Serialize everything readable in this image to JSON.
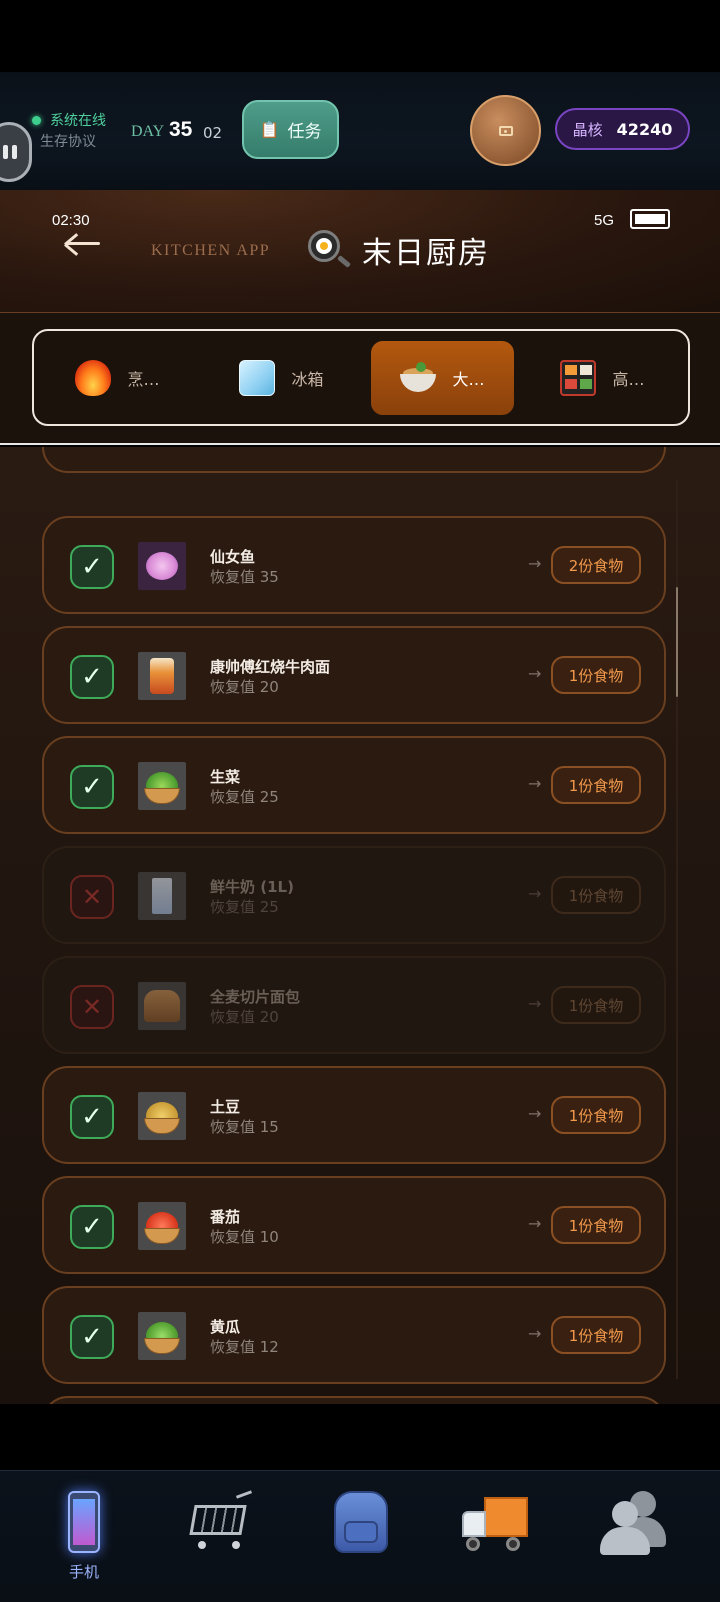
{
  "hud": {
    "status_online": "系统在线",
    "protocol": "生存协议",
    "day_label": "DAY",
    "day_number": "35",
    "day_sub": "02",
    "task_label": "任务",
    "crystal_label": "晶核",
    "crystal_value": "42240"
  },
  "status_bar": {
    "time": "02:30",
    "signal": "5G"
  },
  "app": {
    "subtitle": "KITCHEN APP",
    "title": "末日厨房"
  },
  "tabs": [
    {
      "label": "烹…",
      "icon": "fire-icon",
      "active": false
    },
    {
      "label": "冰箱",
      "icon": "ice-cube-icon",
      "active": false
    },
    {
      "label": "大…",
      "icon": "soup-bowl-icon",
      "active": true
    },
    {
      "label": "高…",
      "icon": "bento-box-icon",
      "active": false
    }
  ],
  "items": [
    {
      "name": "仙女鱼",
      "recovery": "恢复值 35",
      "portion": "2份食物",
      "available": true,
      "icon": "fairy-fish-icon"
    },
    {
      "name": "康帅傅红烧牛肉面",
      "recovery": "恢复值 20",
      "portion": "1份食物",
      "available": true,
      "icon": "instant-noodle-icon"
    },
    {
      "name": "生菜",
      "recovery": "恢复值 25",
      "portion": "1份食物",
      "available": true,
      "icon": "lettuce-basket-icon"
    },
    {
      "name": "鲜牛奶 (1L)",
      "recovery": "恢复值 25",
      "portion": "1份食物",
      "available": false,
      "icon": "milk-carton-icon"
    },
    {
      "name": "全麦切片面包",
      "recovery": "恢复值 20",
      "portion": "1份食物",
      "available": false,
      "icon": "bread-icon"
    },
    {
      "name": "土豆",
      "recovery": "恢复值 15",
      "portion": "1份食物",
      "available": true,
      "icon": "potato-basket-icon"
    },
    {
      "name": "番茄",
      "recovery": "恢复值 10",
      "portion": "1份食物",
      "available": true,
      "icon": "tomato-basket-icon"
    },
    {
      "name": "黄瓜",
      "recovery": "恢复值 12",
      "portion": "1份食物",
      "available": true,
      "icon": "cucumber-basket-icon"
    }
  ],
  "bottom_nav": [
    {
      "label": "手机",
      "icon": "phone-icon",
      "active": true
    },
    {
      "label": "",
      "icon": "shopping-cart-icon",
      "active": false
    },
    {
      "label": "",
      "icon": "backpack-icon",
      "active": false
    },
    {
      "label": "",
      "icon": "delivery-truck-icon",
      "active": false
    },
    {
      "label": "",
      "icon": "people-icon",
      "active": false
    }
  ],
  "colors": {
    "accent_orange": "#b3580f",
    "check_green": "#3eab5a",
    "cross_red": "#6b2520",
    "crystal_purple": "#7a45c2",
    "task_teal": "#4f9d8a"
  }
}
